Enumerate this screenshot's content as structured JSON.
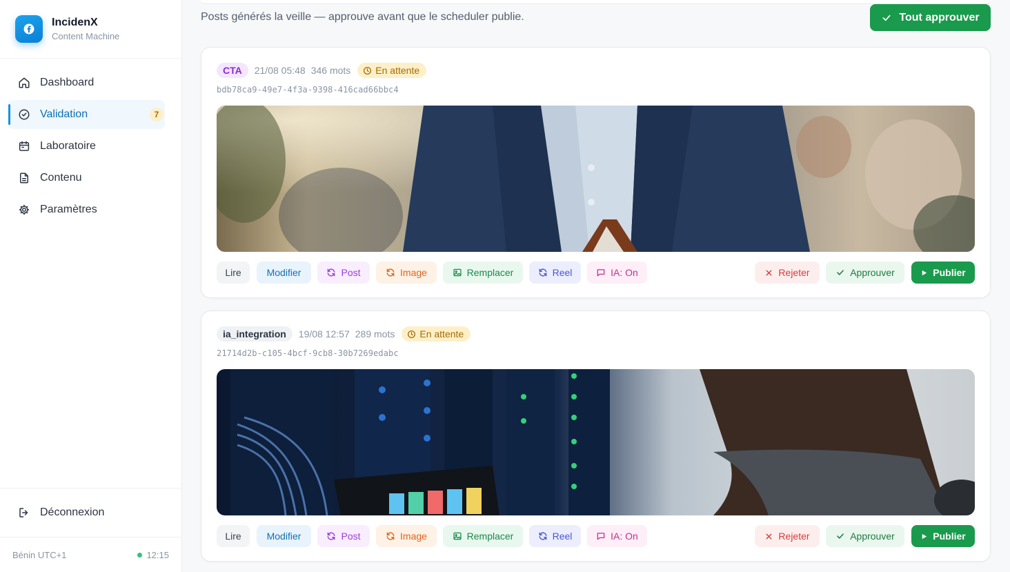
{
  "brand": {
    "name": "IncidenX",
    "subtitle": "Content Machine",
    "logo_icon": "facebook-icon",
    "accent": "#1692e6"
  },
  "nav": [
    {
      "label": "Dashboard",
      "icon": "home-icon"
    },
    {
      "label": "Validation",
      "icon": "check-circle-icon",
      "badge": "7",
      "active": true
    },
    {
      "label": "Laboratoire",
      "icon": "calendar-icon"
    },
    {
      "label": "Contenu",
      "icon": "file-icon"
    },
    {
      "label": "Paramètres",
      "icon": "gear-icon"
    }
  ],
  "logout_label": "Déconnexion",
  "footer": {
    "timezone": "Bénin UTC+1",
    "time": "12:15"
  },
  "page": {
    "subtitle": "Posts générés la veille — approuve avant que le scheduler publie.",
    "approve_all_label": "Tout approuver"
  },
  "posts": [
    {
      "tag": "CTA",
      "date": "21/08 05:48",
      "words": "346 mots",
      "status": "En attente",
      "id": "bdb78ca9-49e7-4f3a-9398-416cad66bbc4",
      "image": "man-in-navy-blazer-office-photo"
    },
    {
      "tag": "ia_integration",
      "date": "19/08 12:57",
      "words": "289 mots",
      "status": "En attente",
      "id": "21714d2b-c105-4bcf-9cb8-30b7269edabc",
      "image": "man-in-server-room-photo"
    }
  ],
  "actions": {
    "read": "Lire",
    "edit": "Modifier",
    "post": "Post",
    "image": "Image",
    "replace": "Remplacer",
    "reel": "Reel",
    "ai": "IA: On",
    "reject": "Rejeter",
    "approve": "Approuver",
    "publish": "Publier"
  },
  "colors": {
    "primary_green": "#1a9a4c",
    "pending_bg": "#fdf0c9",
    "pending_text": "#a86a00"
  }
}
